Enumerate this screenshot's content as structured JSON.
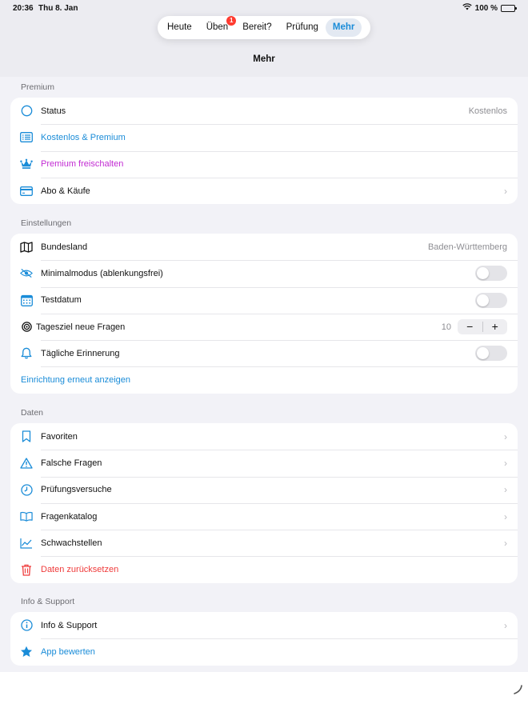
{
  "status_bar": {
    "time": "20:36",
    "date": "Thu 8. Jan",
    "battery": "100 %"
  },
  "tabs": [
    {
      "label": "Heute",
      "active": false
    },
    {
      "label": "Üben",
      "active": false,
      "badge": "1"
    },
    {
      "label": "Bereit?",
      "active": false
    },
    {
      "label": "Prüfung",
      "active": false
    },
    {
      "label": "Mehr",
      "active": true
    }
  ],
  "nav_title": "Mehr",
  "premium": {
    "header": "Premium",
    "status_label": "Status",
    "status_value": "Kostenlos",
    "free_premium": "Kostenlos & Premium",
    "unlock": "Premium freischalten",
    "subscriptions": "Abo & Käufe"
  },
  "settings": {
    "header": "Einstellungen",
    "state_label": "Bundesland",
    "state_value": "Baden-Württemberg",
    "minimal_mode": "Minimalmodus (ablenkungsfrei)",
    "test_date": "Testdatum",
    "daily_goal": "Tagesziel neue Fragen",
    "daily_goal_value": "10",
    "stepper_minus": "−",
    "stepper_plus": "+",
    "reminder": "Tägliche Erinnerung",
    "setup_again": "Einrichtung erneut anzeigen",
    "toggles": {
      "minimal_mode": false,
      "test_date": false,
      "reminder": false
    }
  },
  "data": {
    "header": "Daten",
    "favorites": "Favoriten",
    "wrong_questions": "Falsche Fragen",
    "exam_attempts": "Prüfungsversuche",
    "catalog": "Fragenkatalog",
    "weak_spots": "Schwachstellen",
    "reset": "Daten zurücksetzen"
  },
  "info": {
    "header": "Info & Support",
    "info_support": "Info & Support",
    "rate_app": "App bewerten"
  },
  "colors": {
    "accent": "#1a8cd8",
    "premium": "#c22bd3",
    "destructive": "#ef3b3b",
    "crown": "#1a8cd8",
    "badge": "#ff3b30"
  }
}
